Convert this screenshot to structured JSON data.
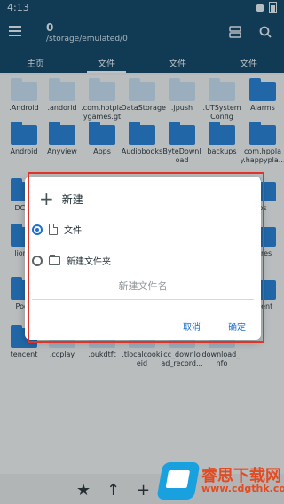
{
  "status_bar": {
    "time": "4:13"
  },
  "header": {
    "count": "0",
    "path": "/storage/emulated/0"
  },
  "tabs": [
    "主页",
    "文件",
    "文件",
    "文件"
  ],
  "items": [
    {
      "label": ".Android"
    },
    {
      "label": ".andorid"
    },
    {
      "label": ".com.hotpla\nygames.gt"
    },
    {
      "label": ".DataStorage"
    },
    {
      "label": ".jpush"
    },
    {
      "label": ".UTSystem\nConfig"
    },
    {
      "label": "Alarms"
    },
    {
      "label": "Android"
    },
    {
      "label": "Anyview"
    },
    {
      "label": "Apps"
    },
    {
      "label": "Audiobooks"
    },
    {
      "label": "ByteDownl\noad"
    },
    {
      "label": "backups"
    },
    {
      "label": "com.hppla\ny.happypla..."
    },
    {
      "label": "DCIM"
    },
    {
      "label": "bs"
    },
    {
      "label": "lionM"
    },
    {
      "label": "tures"
    },
    {
      "label": "Podc"
    },
    {
      "label": "ecent"
    },
    {
      "label": "tencent"
    },
    {
      "label": ".ccplay"
    },
    {
      "label": ".oukdtft"
    },
    {
      "label": ".tlocalcooki\neid"
    },
    {
      "label": "cc_downlo\nad_record..."
    },
    {
      "label": "download_i\nnfo"
    }
  ],
  "dialog": {
    "title": "新建",
    "options": [
      {
        "label": "文件",
        "selected": true
      },
      {
        "label": "新建文件夹",
        "selected": false
      }
    ],
    "input_placeholder": "新建文件名",
    "cancel": "取消",
    "confirm": "确定"
  },
  "watermark": {
    "text": "睿思下载网",
    "url": "www.cdgthk.com"
  }
}
